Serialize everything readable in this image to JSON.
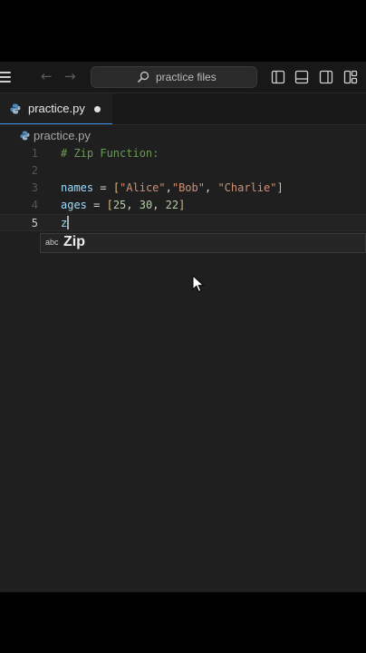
{
  "titlebar": {
    "search_placeholder": "practice files"
  },
  "tab": {
    "label": "practice.py"
  },
  "breadcrumb": {
    "file": "practice.py"
  },
  "editor": {
    "lines": [
      {
        "number": "1",
        "comment": "# Zip Function:"
      },
      {
        "number": "2"
      },
      {
        "number": "3",
        "var": "names",
        "eq": " = ",
        "lb": "[",
        "s1": "\"Alice\"",
        "c1": ",",
        "s2": "\"Bob\"",
        "c2": ", ",
        "s3": "\"Charlie\"",
        "rb": "]"
      },
      {
        "number": "4",
        "var": "ages",
        "eq": " = ",
        "lb": "[",
        "n1": "25",
        "c1": ", ",
        "n2": "30",
        "c2": ", ",
        "n3": "22",
        "rb": "]"
      },
      {
        "number": "5",
        "typed": "z"
      }
    ]
  },
  "suggestion": {
    "kind": "abc",
    "text": "Zip"
  },
  "colors": {
    "accent": "#3b8eea",
    "comment": "#6a9955",
    "string": "#ce9178",
    "number": "#b5cea8",
    "variable": "#9cdcfe"
  }
}
